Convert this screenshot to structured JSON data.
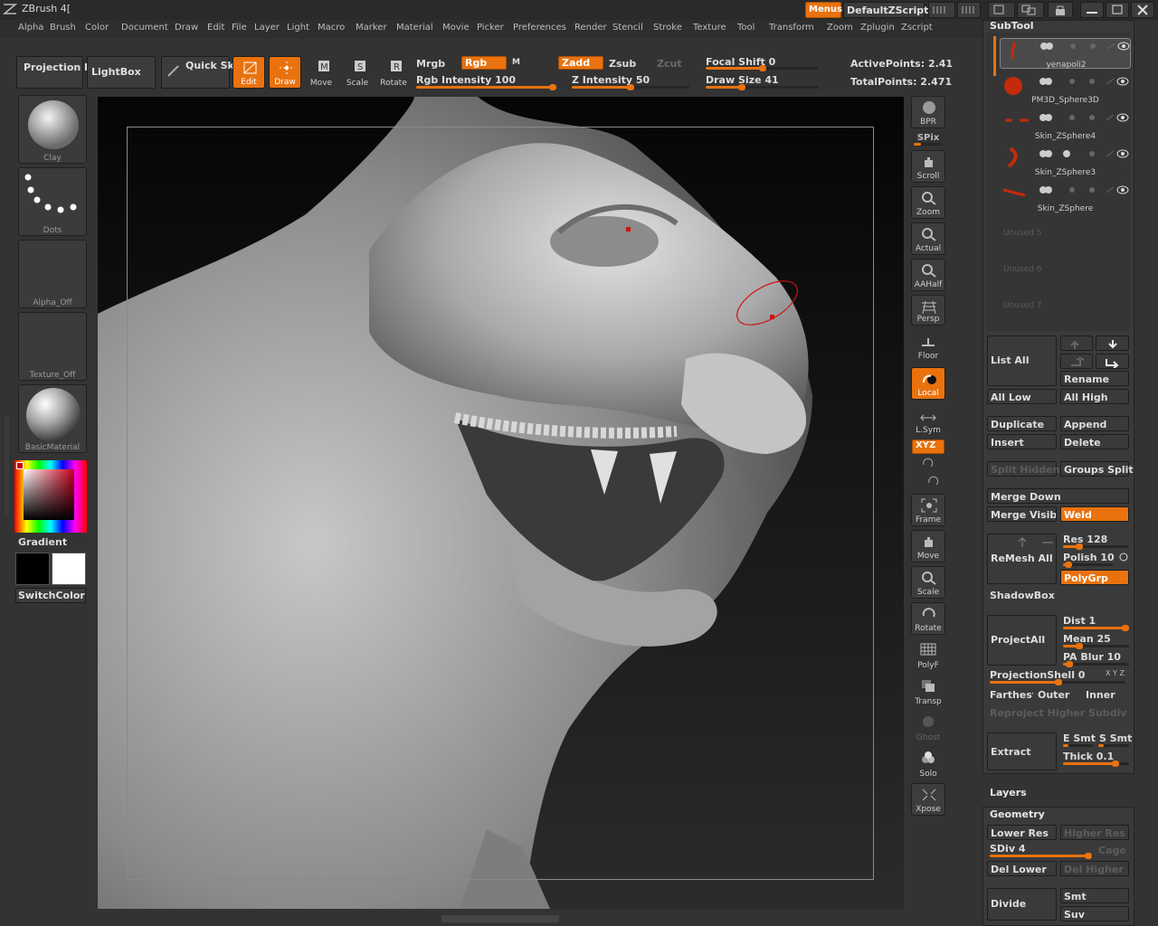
{
  "app": {
    "title": "ZBrush 4[",
    "menus_label": "Menus",
    "script_label": "DefaultZScript"
  },
  "menu": [
    "Alpha",
    "Brush",
    "Color",
    "Document",
    "Draw",
    "Edit",
    "File",
    "Layer",
    "Light",
    "Macro",
    "Marker",
    "Material",
    "Movie",
    "Picker",
    "Preferences",
    "Render",
    "Stencil",
    "Stroke",
    "Texture",
    "Tool",
    "Transform",
    "Zoom",
    "Zplugin",
    "Zscript"
  ],
  "top": {
    "projection_master": "Projection Master",
    "lightbox": "LightBox",
    "quick_sketch": "Quick Sketch",
    "edit": "Edit",
    "draw": "Draw",
    "move": "Move",
    "scale": "Scale",
    "rotate": "Rotate",
    "mrgb": "Mrgb",
    "rgb": "Rgb",
    "m": "M",
    "zadd": "Zadd",
    "zsub": "Zsub",
    "zcut": "Zcut",
    "rgb_intensity": "Rgb Intensity 100",
    "rgb_intensity_value": 100,
    "z_intensity": "Z Intensity 50",
    "z_intensity_value": 50,
    "focal_shift": "Focal Shift 0",
    "focal_shift_value": 0,
    "draw_size": "Draw Size 41",
    "draw_size_value": 41,
    "active_points": "ActivePoints: 2.41",
    "total_points": "TotalPoints: 2.471"
  },
  "left": {
    "brush": "Clay",
    "stroke": "Dots",
    "alpha": "Alpha_Off",
    "texture": "Texture_Off",
    "material": "BasicMaterial",
    "gradient": "Gradient",
    "switch_color": "SwitchColor"
  },
  "right_tools": [
    {
      "name": "bpr",
      "label": "BPR",
      "icon": "bpr-icon"
    },
    {
      "name": "scroll",
      "label": "Scroll",
      "icon": "scroll-icon"
    },
    {
      "name": "zoom",
      "label": "Zoom",
      "icon": "zoom-icon"
    },
    {
      "name": "actual",
      "label": "Actual",
      "icon": "actual-icon"
    },
    {
      "name": "aahalf",
      "label": "AAHalf",
      "icon": "aahalf-icon"
    },
    {
      "name": "persp",
      "label": "Persp",
      "icon": "persp-icon"
    },
    {
      "name": "floor",
      "label": "Floor",
      "icon": "floor-icon"
    },
    {
      "name": "local",
      "label": "Local",
      "icon": "local-icon"
    },
    {
      "name": "lsym",
      "label": "L.Sym",
      "icon": "lsym-icon"
    },
    {
      "name": "xyz",
      "label": "XYZ",
      "icon": "xyz-icon"
    },
    {
      "name": "frame",
      "label": "Frame",
      "icon": "frame-icon"
    },
    {
      "name": "move",
      "label": "Move",
      "icon": "move-icon"
    },
    {
      "name": "scale",
      "label": "Scale",
      "icon": "scale-icon"
    },
    {
      "name": "rotate",
      "label": "Rotate",
      "icon": "rotate-icon"
    },
    {
      "name": "polyf",
      "label": "PolyF",
      "icon": "polyf-icon"
    },
    {
      "name": "transp",
      "label": "Transp",
      "icon": "transp-icon"
    },
    {
      "name": "ghost",
      "label": "Ghost",
      "icon": "ghost-icon"
    },
    {
      "name": "solo",
      "label": "Solo",
      "icon": "solo-icon"
    },
    {
      "name": "xpose",
      "label": "Xpose",
      "icon": "xpose-icon"
    }
  ],
  "spix": "SPix",
  "subtool": {
    "title": "SubTool",
    "items": [
      "yenapoli2",
      "PM3D_Sphere3D",
      "Skin_ZSphere4",
      "Skin_ZSphere3",
      "Skin_ZSphere"
    ],
    "unused": [
      "Unused  5",
      "Unused  6",
      "Unused  7"
    ],
    "list_all": "List  All",
    "rename": "Rename",
    "all_low": "All  Low",
    "all_high": "All  High",
    "duplicate": "Duplicate",
    "append": "Append",
    "insert": "Insert",
    "delete": "Delete",
    "split_hidden": "Split  Hidden",
    "groups_split": "Groups  Split",
    "merge_down": "Merge  Down",
    "merge_visible": "Merge  Visible",
    "weld": "Weld",
    "remesh_all": "ReMesh  All",
    "res": "Res 128",
    "res_value": 128,
    "polish": "Polish 10",
    "polish_value": 10,
    "polygrp": "PolyGrp",
    "shadowbox": "ShadowBox",
    "project_all": "ProjectAll",
    "dist": "Dist 1",
    "dist_value": 1,
    "mean": "Mean 25",
    "mean_value": 25,
    "pa_blur": "PA  Blur 10",
    "pa_blur_value": 10,
    "projection_shell": "ProjectionShell 0",
    "xyz_small": "X Y Z",
    "farthest": "Farthest",
    "outer": "Outer",
    "inner": "Inner",
    "reproject": "Reproject  Higher  Subdiv",
    "extract": "Extract",
    "e_smt": "E Smt",
    "s_smt": "S Smt",
    "thick": "Thick 0.1",
    "thick_value": 0.1
  },
  "layers": {
    "title": "Layers"
  },
  "geometry": {
    "title": "Geometry",
    "lower_res": "Lower Res",
    "higher_res": "Higher Res",
    "sdiv": "SDiv 4",
    "sdiv_value": 4,
    "cage": "Cage",
    "del_lower": "Del Lower",
    "del_higher": "Del Higher",
    "divide": "Divide",
    "smt": "Smt",
    "suv": "Suv"
  }
}
